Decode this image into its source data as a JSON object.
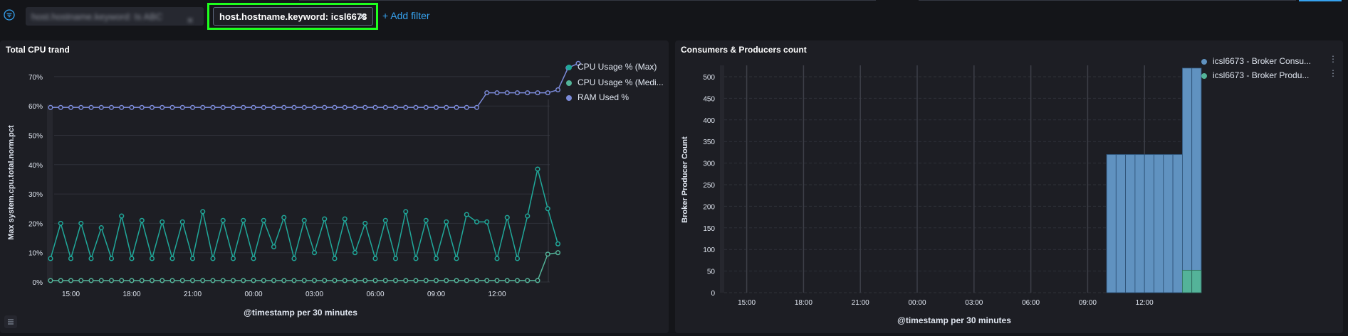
{
  "filterbar": {
    "blurred_filter": "host.hostname.keyword: Is ABC",
    "active_filter": "host.hostname.keyword: icsl6673",
    "add_filter": "+ Add filter"
  },
  "panels": {
    "cpu": {
      "title": "Total CPU trand",
      "ylabel": "Max system.cpu.total.norm.pct",
      "xlabel": "@timestamp per 30 minutes",
      "legend": [
        {
          "label": "CPU Usage % (Max)",
          "color": "#20a89a"
        },
        {
          "label": "CPU Usage % (Medi...",
          "color": "#54b399"
        },
        {
          "label": "RAM Used %",
          "color": "#7b8ad8"
        }
      ]
    },
    "consumers": {
      "title": "Consumers & Producers count",
      "ylabel": "Broker Producer Count",
      "xlabel": "@timestamp per 30 minutes",
      "legend": [
        {
          "label": "icsl6673 - Broker Consu...",
          "color": "#6092c0"
        },
        {
          "label": "icsl6673 - Broker Produ...",
          "color": "#54b399"
        }
      ]
    }
  },
  "chart_data": [
    {
      "type": "line",
      "title": "Total CPU trand",
      "xlabel": "@timestamp per 30 minutes",
      "ylabel": "Max system.cpu.total.norm.pct",
      "x_ticks": [
        "15:00",
        "18:00",
        "21:00",
        "00:00",
        "03:00",
        "06:00",
        "09:00",
        "12:00"
      ],
      "y_ticks": [
        "0%",
        "10%",
        "20%",
        "30%",
        "40%",
        "50%",
        "60%",
        "70%"
      ],
      "ylim": [
        0,
        72
      ],
      "x_start": "14:00",
      "x_step_minutes": 30,
      "series": [
        {
          "name": "CPU Usage % (Max)",
          "color": "#20a89a",
          "values": [
            8,
            20,
            8,
            20,
            8,
            18.5,
            8,
            22.5,
            8,
            21,
            8,
            20.5,
            8,
            20.5,
            8,
            24,
            8,
            21,
            8,
            21,
            8,
            21,
            12,
            22,
            8,
            21,
            10,
            21.5,
            8,
            21.5,
            10,
            20,
            8,
            21,
            8,
            24,
            8,
            21,
            8,
            20.5,
            8,
            23,
            20.5,
            20.5,
            8,
            22,
            8,
            22.5,
            38.5,
            25,
            13
          ]
        },
        {
          "name": "CPU Usage % (Medi...",
          "color": "#54b399",
          "values": [
            0.5,
            0.5,
            0.5,
            0.5,
            0.5,
            0.5,
            0.5,
            0.5,
            0.5,
            0.5,
            0.5,
            0.5,
            0.5,
            0.5,
            0.5,
            0.5,
            0.5,
            0.5,
            0.5,
            0.5,
            0.5,
            0.5,
            0.5,
            0.5,
            0.5,
            0.5,
            0.5,
            0.5,
            0.5,
            0.5,
            0.5,
            0.5,
            0.5,
            0.5,
            0.5,
            0.5,
            0.5,
            0.5,
            0.5,
            0.5,
            0.5,
            0.5,
            0.5,
            0.5,
            0.5,
            0.5,
            0.5,
            0.5,
            0.5,
            9.5,
            10
          ]
        },
        {
          "name": "RAM Used %",
          "color": "#7b8ad8",
          "values": [
            59.5,
            59.5,
            59.5,
            59.5,
            59.5,
            59.5,
            59.5,
            59.5,
            59.5,
            59.5,
            59.5,
            59.5,
            59.5,
            59.5,
            59.5,
            59.5,
            59.5,
            59.5,
            59.5,
            59.5,
            59.5,
            59.5,
            59.5,
            59.5,
            59.5,
            59.5,
            59.5,
            59.5,
            59.5,
            59.5,
            59.5,
            59.5,
            59.5,
            59.5,
            59.5,
            59.5,
            59.5,
            59.5,
            59.5,
            59.5,
            59.5,
            59.5,
            59.5,
            64.5,
            64.5,
            64.5,
            64.5,
            64.5,
            64.5,
            64.5,
            65.5,
            73,
            74.5
          ]
        }
      ]
    },
    {
      "type": "bar",
      "title": "Consumers & Producers count",
      "xlabel": "@timestamp per 30 minutes",
      "ylabel": "Broker Producer Count",
      "x_ticks": [
        "15:00",
        "18:00",
        "21:00",
        "00:00",
        "03:00",
        "06:00",
        "09:00",
        "12:00"
      ],
      "y_ticks": [
        "0",
        "50",
        "100",
        "150",
        "200",
        "250",
        "300",
        "350",
        "400",
        "450",
        "500"
      ],
      "ylim": [
        0,
        520
      ],
      "x_start": "14:00",
      "x_step_minutes": 30,
      "bars_start_index": 40,
      "series": [
        {
          "name": "icsl6673 - Broker Consu...",
          "color": "#6092c0",
          "values": [
            320,
            320,
            320,
            320,
            320,
            320,
            320,
            320,
            520,
            520
          ]
        },
        {
          "name": "icsl6673 - Broker Produ...",
          "color": "#54b399",
          "values": [
            0,
            0,
            0,
            0,
            0,
            0,
            0,
            0,
            52,
            52
          ]
        }
      ]
    }
  ]
}
